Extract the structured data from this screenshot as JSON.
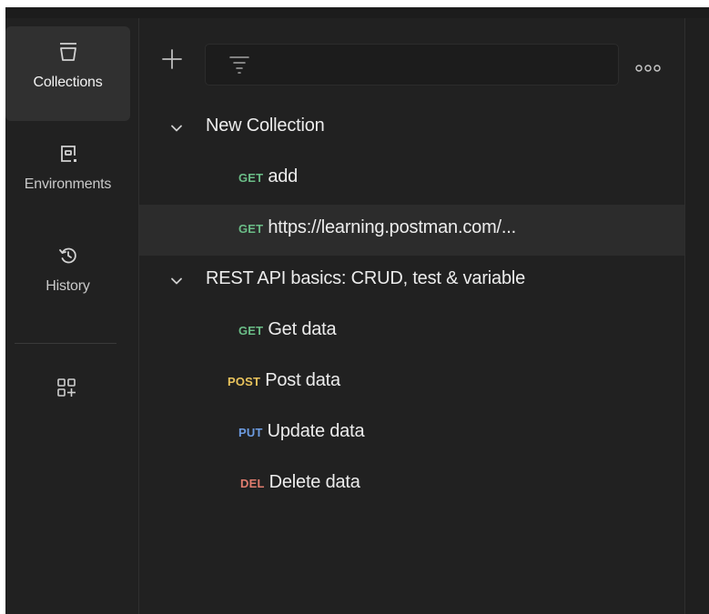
{
  "rail": {
    "items": [
      {
        "label": "Collections",
        "icon": "collections-icon",
        "active": true
      },
      {
        "label": "Environments",
        "icon": "environments-icon",
        "active": false
      },
      {
        "label": "History",
        "icon": "history-icon",
        "active": false
      }
    ],
    "more_icon": "add-apps-icon"
  },
  "toolbar": {
    "add_icon": "plus-icon",
    "filter_icon": "filter-icon",
    "more_icon": "more-options-icon"
  },
  "collections": [
    {
      "name": "New Collection",
      "expanded": true,
      "requests": [
        {
          "method": "GET",
          "name": "add"
        },
        {
          "method": "GET",
          "name": "https://learning.postman.com/...",
          "selected": true
        }
      ]
    },
    {
      "name": "REST API basics: CRUD, test & variable",
      "expanded": true,
      "requests": [
        {
          "method": "GET",
          "name": "Get data"
        },
        {
          "method": "POST",
          "name": "Post data"
        },
        {
          "method": "PUT",
          "name": "Update data"
        },
        {
          "method": "DEL",
          "name": "Delete data"
        }
      ]
    }
  ],
  "method_colors": {
    "GET": "#6bbd87",
    "POST": "#e9c35c",
    "PUT": "#6c9be0",
    "DEL": "#e07c6e"
  },
  "theme": {
    "background": "#212121",
    "selected_row": "#2c2c2c",
    "active_rail": "#303030"
  }
}
